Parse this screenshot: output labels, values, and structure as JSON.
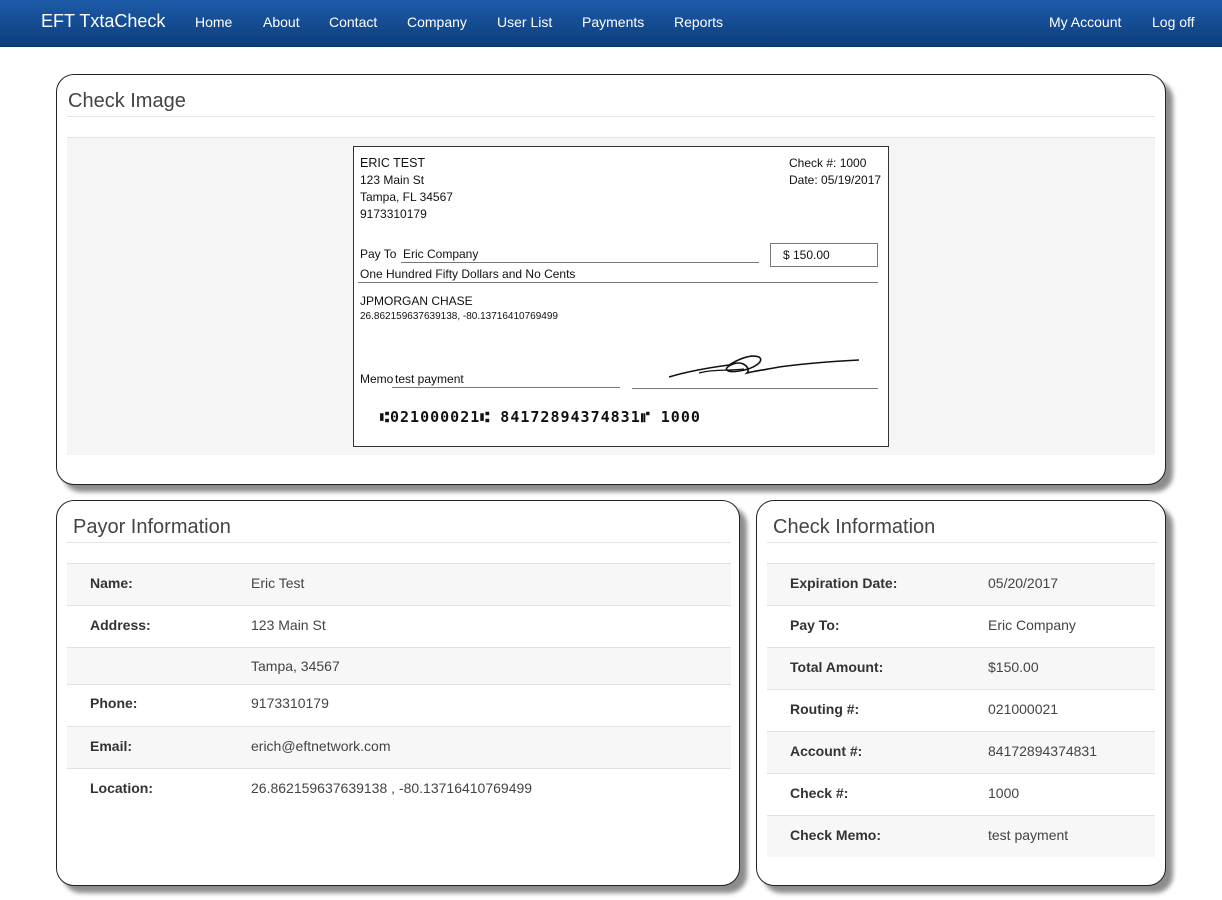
{
  "nav": {
    "brand": "EFT TxtaCheck",
    "links": [
      "Home",
      "About",
      "Contact",
      "Company",
      "User List",
      "Payments",
      "Reports"
    ],
    "right": [
      "My Account",
      "Log off"
    ]
  },
  "check_image": {
    "title": "Check Image",
    "check": {
      "payer_name": "ERIC TEST",
      "payer_street": "123 Main St",
      "payer_city": "Tampa, FL 34567",
      "payer_phone": "9173310179",
      "check_no": "Check #: 1000",
      "date": "Date: 05/19/2017",
      "pay_to_label": "Pay To",
      "pay_to": "Eric Company",
      "amount": "$ 150.00",
      "amount_words": "One Hundred Fifty  Dollars and No Cents",
      "bank": "JPMORGAN CHASE",
      "coords": "26.862159637639138,  -80.13716410769499",
      "memo_label": "Memo",
      "memo": "test payment",
      "micr": "⑆021000021⑆ 84172894374831⑈ 1000"
    }
  },
  "payor": {
    "title": "Payor Information",
    "rows": [
      {
        "label": "Name:",
        "value": "Eric Test"
      },
      {
        "label": "Address:",
        "value": "123 Main St"
      },
      {
        "label": "",
        "value": "Tampa,  34567"
      },
      {
        "label": "Phone:",
        "value": "9173310179"
      },
      {
        "label": "Email:",
        "value": "erich@eftnetwork.com"
      },
      {
        "label": "Location:",
        "value": "26.862159637639138 , -80.13716410769499"
      }
    ]
  },
  "check_info": {
    "title": "Check Information",
    "rows": [
      {
        "label": "Expiration Date:",
        "value": "05/20/2017"
      },
      {
        "label": "Pay To:",
        "value": "Eric Company"
      },
      {
        "label": "Total Amount:",
        "value": "$150.00"
      },
      {
        "label": "Routing #:",
        "value": "021000021"
      },
      {
        "label": "Account #:",
        "value": "84172894374831"
      },
      {
        "label": "Check #:",
        "value": "1000"
      },
      {
        "label": "Check Memo:",
        "value": "test payment"
      }
    ]
  }
}
